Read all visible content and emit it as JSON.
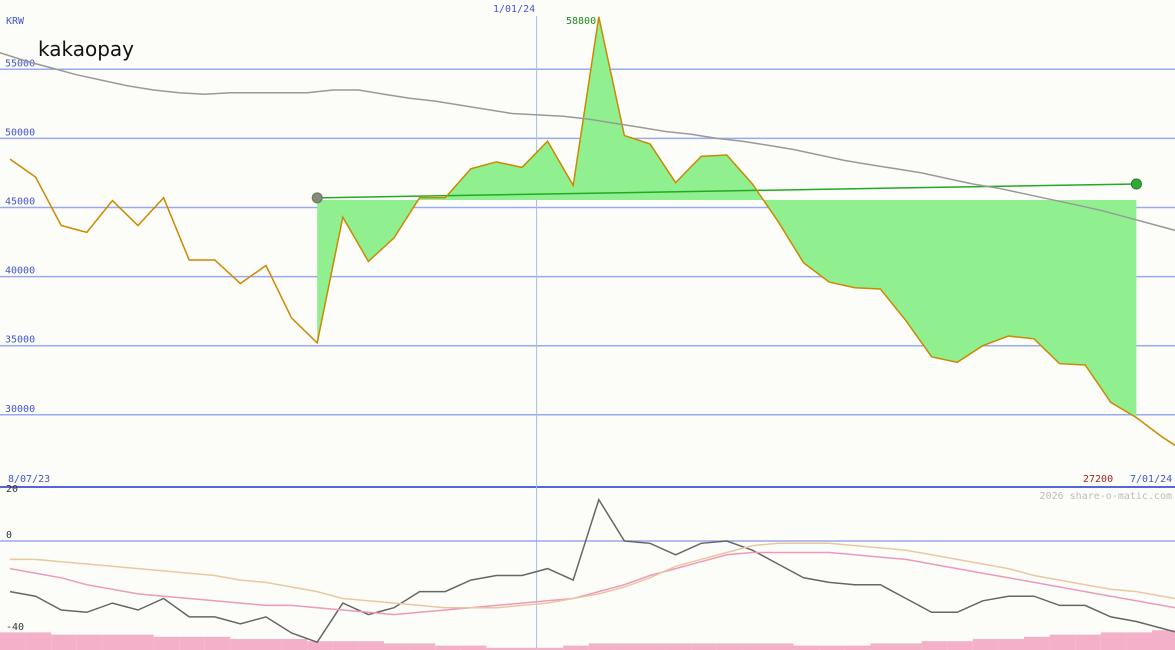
{
  "chart_data": [
    {
      "type": "line",
      "ticker": "kakaopay",
      "currency": "KRW",
      "start_label": "8/07/23",
      "end_label": "7/01/24",
      "marker_label": "1/01/24",
      "high_label": "58800",
      "low_label": "27200",
      "credit": "2026 share-o-matic.com",
      "ylim": [
        26000,
        59500
      ],
      "yticks": [
        30000,
        35000,
        40000,
        45000,
        50000,
        55000
      ],
      "grid": true,
      "x": [
        "8/07/23",
        "8/14/23",
        "8/21/23",
        "8/28/23",
        "9/04/23",
        "9/11/23",
        "9/18/23",
        "9/25/23",
        "10/02/23",
        "10/09/23",
        "10/16/23",
        "10/23/23",
        "10/30/23",
        "11/06/23",
        "11/13/23",
        "11/20/23",
        "11/27/23",
        "12/04/23",
        "12/11/23",
        "12/18/23",
        "12/25/23",
        "1/01/24",
        "1/08/24",
        "1/15/24",
        "1/22/24",
        "1/29/24",
        "2/05/24",
        "2/12/24",
        "2/19/24",
        "2/26/24",
        "3/04/24",
        "3/11/24",
        "3/18/24",
        "3/25/24",
        "4/01/24",
        "4/08/24",
        "4/15/24",
        "4/22/24",
        "4/29/24",
        "5/06/24",
        "5/13/24",
        "5/20/24",
        "5/27/24",
        "6/03/24",
        "6/10/24",
        "6/17/24",
        "6/24/24",
        "7/01/24"
      ],
      "series": [
        {
          "color": "#cc8800",
          "values": [
            48500,
            47200,
            43700,
            43200,
            45500,
            43700,
            45700,
            41200,
            41200,
            39500,
            40800,
            37000,
            35200,
            44300,
            41100,
            42800,
            45700,
            45700,
            47800,
            48300,
            47900,
            49800,
            46600,
            58800,
            50200,
            49600,
            46800,
            48700,
            48800,
            46700,
            44000,
            41000,
            39600,
            39200,
            39100,
            36800,
            34200,
            33800,
            35000,
            35700,
            35500,
            33700,
            33600,
            30900,
            29800,
            28400,
            27200
          ]
        },
        {
          "color": "#999999",
          "values": [
            56200,
            55600,
            55100,
            54600,
            54200,
            53800,
            53500,
            53300,
            53200,
            53300,
            53300,
            53300,
            53300,
            53500,
            53500,
            53200,
            52900,
            52700,
            52400,
            52100,
            51800,
            51700,
            51600,
            51400,
            51100,
            50800,
            50500,
            50300,
            50000,
            49800,
            49500,
            49200,
            48800,
            48400,
            48100,
            47800,
            47500,
            47100,
            46700,
            46400,
            46000,
            45600,
            45200,
            44800,
            44300,
            43800,
            43300,
            42800,
            42300
          ]
        }
      ],
      "highlight": {
        "from": "10/30/23",
        "to": "6/10/24",
        "from_value": 45700,
        "to_value": 46700,
        "fill": "#90f090",
        "line": "#22aa22"
      }
    },
    {
      "type": "line",
      "ylim": [
        -41,
        23
      ],
      "yticks": [
        20,
        0,
        -40
      ],
      "series": [
        {
          "color": "#666666",
          "values": [
            -22,
            -24,
            -30,
            -31,
            -27,
            -30,
            -25,
            -33,
            -33,
            -36,
            -33,
            -40,
            -44,
            -27,
            -32,
            -29,
            -22,
            -22,
            -17,
            -15,
            -15,
            -12,
            -17,
            18,
            0,
            -1,
            -6,
            -1,
            0,
            -4,
            -10,
            -16,
            -18,
            -19,
            -19,
            -25,
            -31,
            -31,
            -26,
            -24,
            -24,
            -28,
            -28,
            -33,
            -35,
            -38,
            -41
          ]
        },
        {
          "color": "#ee99bb",
          "values": [
            -12,
            -14,
            -16,
            -19,
            -21,
            -23,
            -24,
            -25,
            -26,
            -27,
            -28,
            -28,
            -29,
            -30,
            -31,
            -32,
            -31,
            -30,
            -29,
            -28,
            -27,
            -26,
            -25,
            -22,
            -19,
            -15,
            -12,
            -9,
            -6,
            -5,
            -5,
            -5,
            -5,
            -6,
            -7,
            -8,
            -10,
            -12,
            -14,
            -16,
            -18,
            -20,
            -22,
            -24,
            -26,
            -28,
            -30
          ]
        },
        {
          "color": "#e8c8a0",
          "values": [
            -8,
            -8,
            -9,
            -10,
            -11,
            -12,
            -13,
            -14,
            -15,
            -17,
            -18,
            -20,
            -22,
            -25,
            -26,
            -27,
            -28,
            -29,
            -29,
            -29,
            -28,
            -27,
            -25,
            -23,
            -20,
            -16,
            -11,
            -8,
            -5,
            -2,
            -1,
            -1,
            -1,
            -2,
            -3,
            -4,
            -6,
            -8,
            -10,
            -12,
            -15,
            -17,
            -19,
            -21,
            -22,
            -24,
            -26
          ]
        }
      ],
      "volume": [
        8,
        8,
        7,
        7,
        7,
        7,
        6,
        6,
        6,
        5,
        5,
        5,
        4,
        4,
        4,
        3,
        3,
        2,
        2,
        1,
        1,
        1,
        2,
        3,
        3,
        3,
        3,
        3,
        3,
        3,
        3,
        2,
        2,
        2,
        3,
        3,
        4,
        4,
        5,
        5,
        6,
        7,
        7,
        8,
        8,
        9,
        9
      ]
    }
  ]
}
